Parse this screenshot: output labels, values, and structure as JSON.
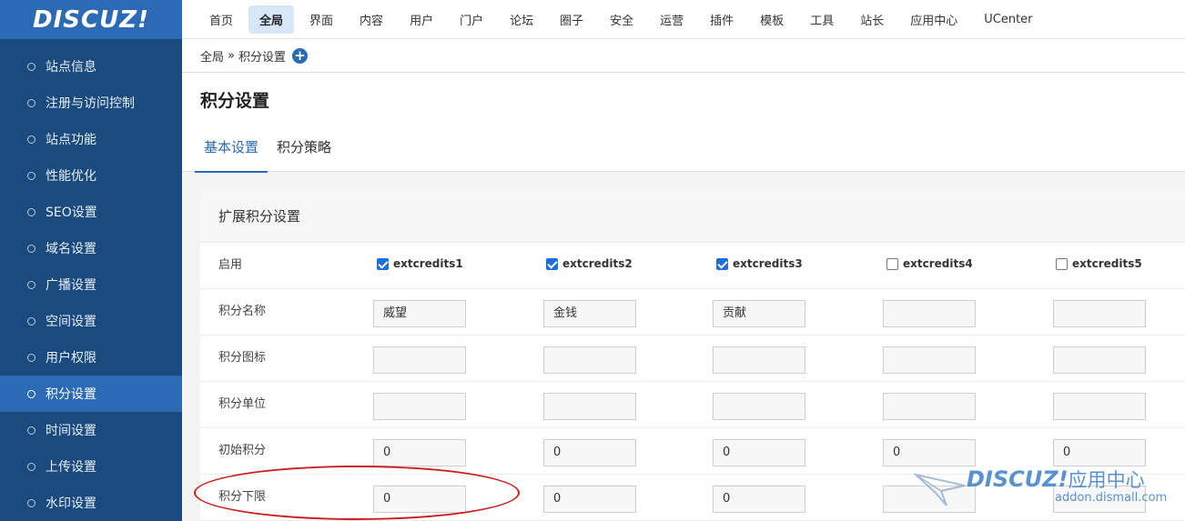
{
  "logo": "DISCUZ!",
  "sidebar": {
    "items": [
      {
        "label": "站点信息"
      },
      {
        "label": "注册与访问控制"
      },
      {
        "label": "站点功能"
      },
      {
        "label": "性能优化"
      },
      {
        "label": "SEO设置"
      },
      {
        "label": "域名设置"
      },
      {
        "label": "广播设置"
      },
      {
        "label": "空间设置"
      },
      {
        "label": "用户权限"
      },
      {
        "label": "积分设置"
      },
      {
        "label": "时间设置"
      },
      {
        "label": "上传设置"
      },
      {
        "label": "水印设置"
      }
    ],
    "active_index": 9
  },
  "topnav": {
    "items": [
      "首页",
      "全局",
      "界面",
      "内容",
      "用户",
      "门户",
      "论坛",
      "圈子",
      "安全",
      "运营",
      "插件",
      "模板",
      "工具",
      "站长",
      "应用中心",
      "UCenter"
    ],
    "active_index": 1
  },
  "breadcrumb": {
    "root": "全局",
    "sep": "»",
    "current": "积分设置",
    "add": "+"
  },
  "page": {
    "title": "积分设置",
    "tabs": [
      {
        "label": "基本设置"
      },
      {
        "label": "积分策略"
      }
    ],
    "active_tab": 0
  },
  "panel": {
    "title": "扩展积分设置",
    "enable_label": "启用",
    "columns": [
      {
        "name": "extcredits1",
        "enabled": true
      },
      {
        "name": "extcredits2",
        "enabled": true
      },
      {
        "name": "extcredits3",
        "enabled": true
      },
      {
        "name": "extcredits4",
        "enabled": false
      },
      {
        "name": "extcredits5",
        "enabled": false
      }
    ],
    "rows": [
      {
        "label": "积分名称",
        "values": [
          "威望",
          "金钱",
          "贡献",
          "",
          ""
        ]
      },
      {
        "label": "积分图标",
        "values": [
          "",
          "",
          "",
          "",
          ""
        ]
      },
      {
        "label": "积分单位",
        "values": [
          "",
          "",
          "",
          "",
          ""
        ]
      },
      {
        "label": "初始积分",
        "values": [
          "0",
          "0",
          "0",
          "0",
          "0"
        ]
      },
      {
        "label": "积分下限",
        "values": [
          "0",
          "0",
          "0",
          "",
          ""
        ]
      }
    ]
  },
  "watermark": {
    "brand": "DISCUZ!",
    "suffix": "应用中心",
    "url": "addon.dismall.com"
  },
  "colors": {
    "sidebar": "#1b4a7e",
    "accent": "#2b6bb5",
    "annotation": "#c82020"
  }
}
